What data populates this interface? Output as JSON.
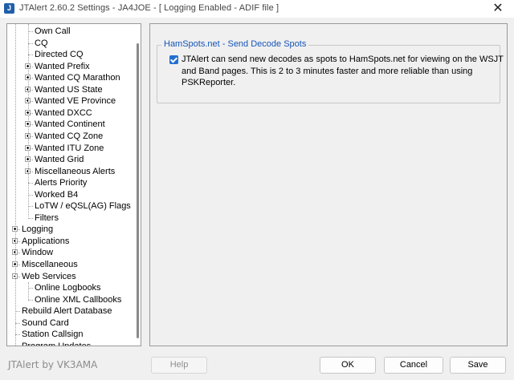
{
  "window": {
    "title": "JTAlert 2.60.2 Settings  -  JA4JOE  -  [ Logging Enabled - ADIF file ]",
    "app_icon": "jtalert-icon",
    "close_glyph": "✕"
  },
  "tree": {
    "items": [
      {
        "label": "Own Call",
        "expander": "none"
      },
      {
        "label": "CQ",
        "expander": "none"
      },
      {
        "label": "Directed CQ",
        "expander": "none"
      },
      {
        "label": "Wanted Prefix",
        "expander": "plus"
      },
      {
        "label": "Wanted CQ Marathon",
        "expander": "plus"
      },
      {
        "label": "Wanted US State",
        "expander": "plus"
      },
      {
        "label": "Wanted VE Province",
        "expander": "plus"
      },
      {
        "label": "Wanted DXCC",
        "expander": "plus"
      },
      {
        "label": "Wanted Continent",
        "expander": "plus"
      },
      {
        "label": "Wanted CQ Zone",
        "expander": "plus"
      },
      {
        "label": "Wanted ITU Zone",
        "expander": "plus"
      },
      {
        "label": "Wanted Grid",
        "expander": "plus"
      },
      {
        "label": "Miscellaneous Alerts",
        "expander": "plus"
      },
      {
        "label": "Alerts Priority",
        "expander": "none"
      },
      {
        "label": "Worked B4",
        "expander": "none"
      },
      {
        "label": "LoTW / eQSL(AG) Flags",
        "expander": "none"
      },
      {
        "label": "Filters",
        "expander": "none"
      },
      {
        "label": "Logging",
        "expander": "plus"
      },
      {
        "label": "Applications",
        "expander": "plus"
      },
      {
        "label": "Window",
        "expander": "plus"
      },
      {
        "label": "Miscellaneous",
        "expander": "plus"
      },
      {
        "label": "Web Services",
        "expander": "minus"
      },
      {
        "label": "Online Logbooks",
        "expander": "none"
      },
      {
        "label": "Online XML Callbooks",
        "expander": "none"
      },
      {
        "label": "Rebuild Alert Database",
        "expander": "none"
      },
      {
        "label": "Sound Card",
        "expander": "none"
      },
      {
        "label": "Station Callsign",
        "expander": "none"
      },
      {
        "label": "Program Updates",
        "expander": "none"
      }
    ]
  },
  "hamspots": {
    "group_title": "HamSpots.net - Send Decode Spots",
    "checkbox_checked": true,
    "checkbox_label": "JTAlert can send new decodes as spots to HamSpots.net for viewing on the WSJT and Band pages. This is 2 to 3 minutes faster and more reliable than using PSKReporter."
  },
  "footer": {
    "branding": "JTAlert by VK3AMA",
    "help_label": "Help",
    "ok_label": "OK",
    "cancel_label": "Cancel",
    "save_label": "Save"
  },
  "colors": {
    "group_title": "#1555b8",
    "checkbox_fill": "#1f6fd1"
  }
}
